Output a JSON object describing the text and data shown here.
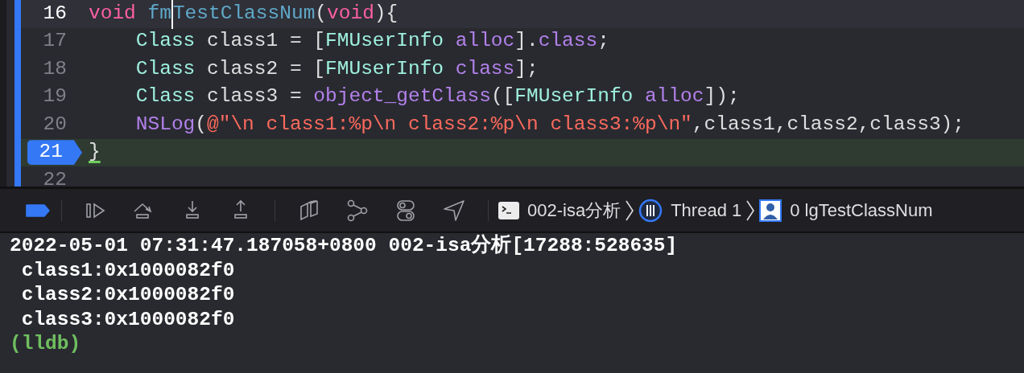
{
  "editor": {
    "lines": [
      {
        "number": "16",
        "cursor_line": true,
        "current": false,
        "indent": false,
        "tokens": [
          {
            "text": "void",
            "kind": "keyword"
          },
          {
            "text": "fm",
            "kind": "declaration",
            "caret": true,
            "space_before": true
          },
          {
            "text": "TestClassNum",
            "kind": "declaration"
          },
          {
            "text": "(",
            "kind": "plain"
          },
          {
            "text": "void",
            "kind": "keyword"
          },
          {
            "text": "){",
            "kind": "plain"
          }
        ]
      },
      {
        "number": "17",
        "cursor_line": false,
        "current": false,
        "indent": true,
        "tokens": [
          {
            "text": "Class",
            "kind": "type"
          },
          {
            "text": "class1 = [",
            "kind": "plain",
            "space_before": true
          },
          {
            "text": "FMUserInfo",
            "kind": "type"
          },
          {
            "text": "alloc",
            "kind": "method",
            "space_before": true
          },
          {
            "text": "].",
            "kind": "plain"
          },
          {
            "text": "class",
            "kind": "method"
          },
          {
            "text": ";",
            "kind": "plain"
          }
        ]
      },
      {
        "number": "18",
        "cursor_line": false,
        "current": false,
        "indent": true,
        "tokens": [
          {
            "text": "Class",
            "kind": "type"
          },
          {
            "text": "class2 = [",
            "kind": "plain",
            "space_before": true
          },
          {
            "text": "FMUserInfo",
            "kind": "type"
          },
          {
            "text": "class",
            "kind": "method",
            "space_before": true
          },
          {
            "text": "];",
            "kind": "plain"
          }
        ]
      },
      {
        "number": "19",
        "cursor_line": false,
        "current": false,
        "indent": true,
        "tokens": [
          {
            "text": "Class",
            "kind": "type"
          },
          {
            "text": "class3 = ",
            "kind": "plain",
            "space_before": true
          },
          {
            "text": "object_getClass",
            "kind": "method"
          },
          {
            "text": "([",
            "kind": "plain"
          },
          {
            "text": "FMUserInfo",
            "kind": "type"
          },
          {
            "text": "alloc",
            "kind": "method",
            "space_before": true
          },
          {
            "text": "]);",
            "kind": "plain"
          }
        ]
      },
      {
        "number": "20",
        "cursor_line": false,
        "current": false,
        "indent": true,
        "tokens": [
          {
            "text": "NSLog",
            "kind": "method"
          },
          {
            "text": "(",
            "kind": "plain"
          },
          {
            "text": "@\"\\n class1:%p\\n class2:%p\\n class3:%p\\n\"",
            "kind": "string"
          },
          {
            "text": ",class1,class2,class3);",
            "kind": "plain"
          }
        ]
      },
      {
        "number": "21",
        "cursor_line": false,
        "current": true,
        "indent": false,
        "tokens": [
          {
            "text": "}",
            "kind": "matched-brace"
          }
        ]
      },
      {
        "number": "22",
        "cursor_line": false,
        "current": false
      }
    ]
  },
  "debug_bar": {
    "tools": [
      {
        "kind": "breakpoints",
        "on": true
      },
      {
        "kind": "separator"
      },
      {
        "kind": "continue"
      },
      {
        "kind": "step-over"
      },
      {
        "kind": "step-into"
      },
      {
        "kind": "step-out"
      },
      {
        "kind": "separator"
      },
      {
        "kind": "view-hierarchy"
      },
      {
        "kind": "memory-graph"
      },
      {
        "kind": "environment"
      },
      {
        "kind": "location"
      },
      {
        "kind": "separator"
      }
    ],
    "breadcrumbs": [
      {
        "kind": "process",
        "label": "002-isa分析"
      },
      {
        "kind": "thread",
        "label": "Thread 1"
      },
      {
        "kind": "frame",
        "label": "0 lgTestClassNum"
      }
    ]
  },
  "console": {
    "lines": [
      {
        "kind": "output",
        "text": "2022-05-01 07:31:47.187058+0800 002-isa分析[17288:528635]"
      },
      {
        "kind": "output",
        "text": " class1:0x1000082f0"
      },
      {
        "kind": "output",
        "text": " class2:0x1000082f0"
      },
      {
        "kind": "output",
        "text": " class3:0x1000082f0"
      },
      {
        "kind": "prompt",
        "text": "(lldb)"
      }
    ]
  }
}
